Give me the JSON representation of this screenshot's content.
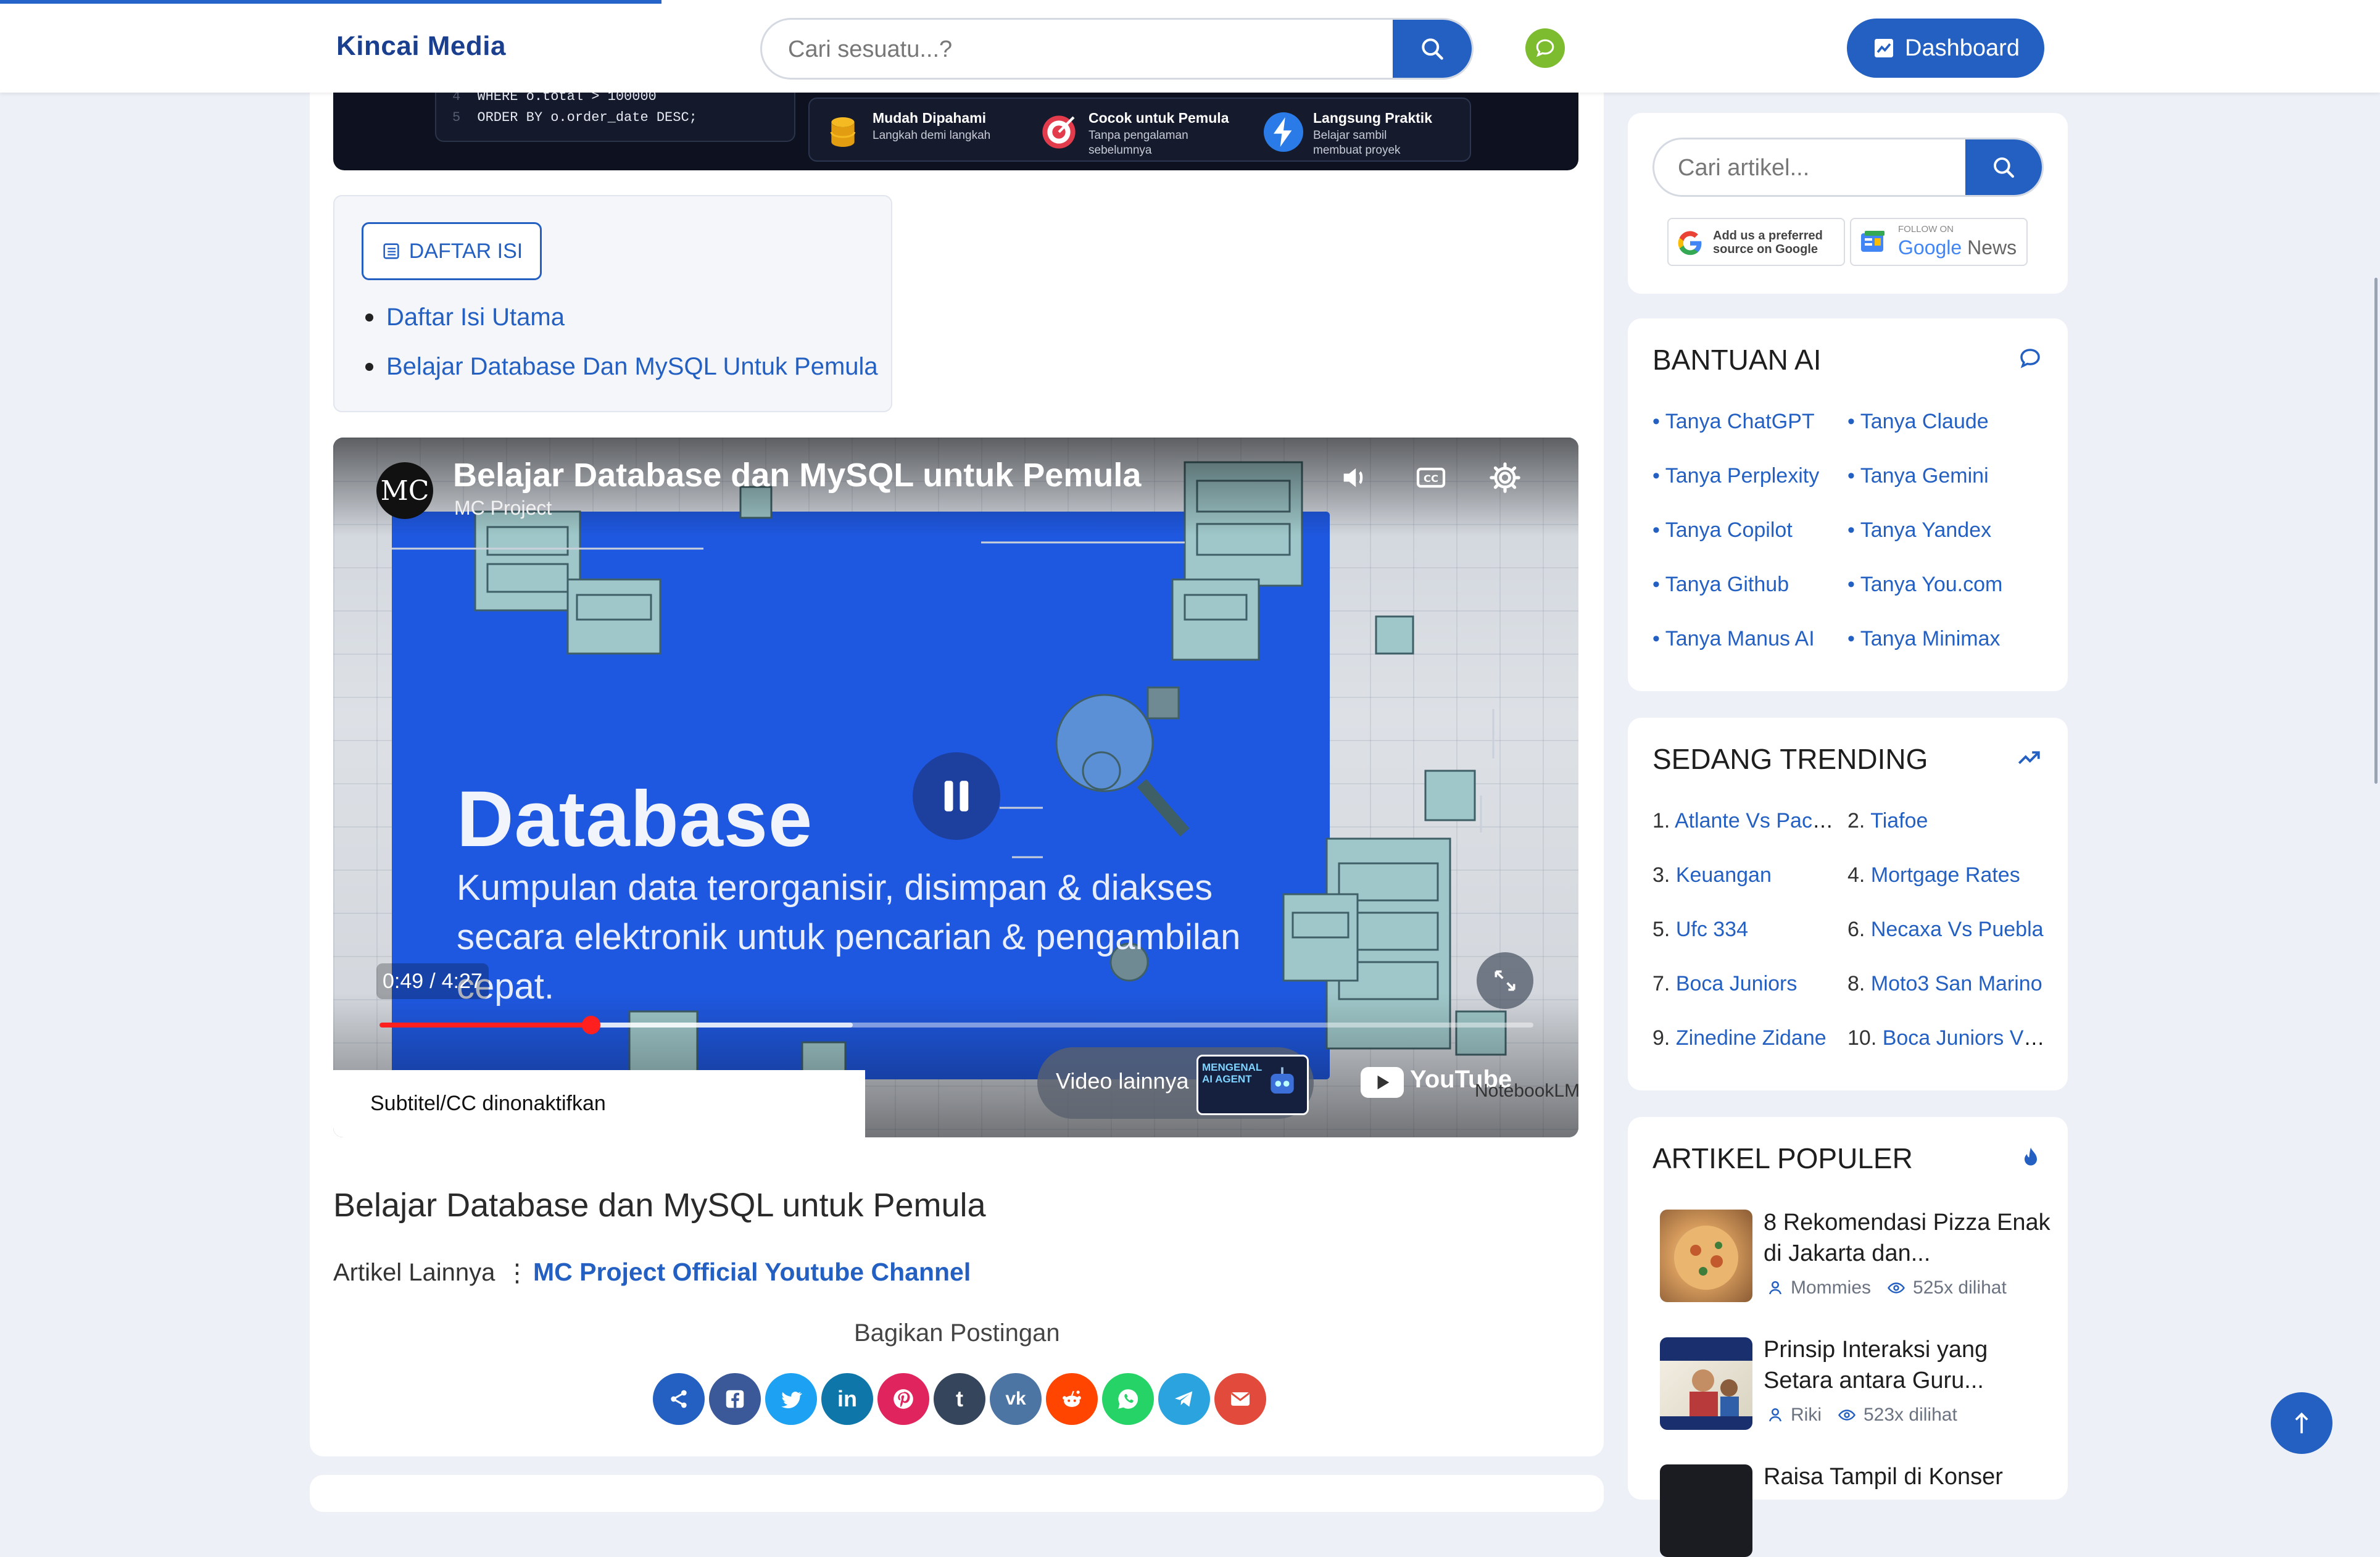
{
  "header": {
    "logo": "Kincai Media",
    "search_placeholder": "Cari sesuatu...?",
    "dashboard_label": "Dashboard"
  },
  "banner": {
    "code_lines": [
      {
        "no": "4",
        "text": "WHERE o.total > 100000"
      },
      {
        "no": "5",
        "text": "ORDER BY o.order_date DESC;"
      }
    ],
    "features": [
      {
        "title": "Mudah Dipahami",
        "sub": "Langkah demi langkah"
      },
      {
        "title": "Cocok untuk Pemula",
        "sub": "Tanpa pengalaman sebelumnya"
      },
      {
        "title": "Langsung Praktik",
        "sub": "Belajar sambil membuat proyek"
      }
    ]
  },
  "toc": {
    "button_label": "DAFTAR ISI",
    "items": [
      "Daftar Isi Utama",
      "Belajar Database Dan MySQL Untuk Pemula"
    ]
  },
  "video": {
    "avatar": "MC",
    "title": "Belajar Database dan MySQL untuk Pemula",
    "channel": "MC Project",
    "slide_headline": "Database",
    "slide_desc": "Kumpulan data terorganisir, disimpan & diakses secara elektronik untuk pencarian & pengambilan cepat.",
    "time_current": "0:49",
    "time_total": "4:27",
    "progress": 0.1835,
    "buffered": 0.41,
    "subtitle_status": "Subtitel/CC dinonaktifkan",
    "more_videos": "Video lainnya",
    "more_thumb_text": "MENGENAL AI AGENT",
    "youtube": "YouTube",
    "notebook": "NotebookLM"
  },
  "article": {
    "title": "Belajar Database dan MySQL untuk Pemula",
    "more_label": "Artikel Lainnya",
    "more_sep": "⋮",
    "more_link": "MC Project Official Youtube Channel",
    "share_label": "Bagikan Postingan"
  },
  "share_buttons": [
    {
      "name": "share",
      "glyph": "⋖",
      "color": "#2460c2"
    },
    {
      "name": "facebook",
      "glyph": "f",
      "color": "#3b5998"
    },
    {
      "name": "twitter",
      "glyph": "t",
      "color": "#1da1f2"
    },
    {
      "name": "linkedin",
      "glyph": "in",
      "color": "#0e76a8"
    },
    {
      "name": "pinterest",
      "glyph": "P",
      "color": "#e0245e"
    },
    {
      "name": "tumblr",
      "glyph": "t",
      "color": "#35465c"
    },
    {
      "name": "vk",
      "glyph": "vk",
      "color": "#4c75a3"
    },
    {
      "name": "reddit",
      "glyph": "r",
      "color": "#ff4500"
    },
    {
      "name": "whatsapp",
      "glyph": "w",
      "color": "#25d366"
    },
    {
      "name": "telegram",
      "glyph": "➤",
      "color": "#2aa3df"
    },
    {
      "name": "email",
      "glyph": "✉",
      "color": "#e24a3b"
    }
  ],
  "sidebar": {
    "search_placeholder": "Cari artikel...",
    "badge_google_line1": "Add us a preferred",
    "badge_google_line2": "source on Google",
    "badge_news_small": "FOLLOW ON",
    "badge_news_google": "Google",
    "badge_news_word": "News",
    "ai": {
      "title": "BANTUAN AI",
      "links": [
        "Tanya ChatGPT",
        "Tanya Claude",
        "Tanya Perplexity",
        "Tanya Gemini",
        "Tanya Copilot",
        "Tanya Yandex",
        "Tanya Github",
        "Tanya You.com",
        "Tanya Manus AI",
        "Tanya Minimax"
      ]
    },
    "trending": {
      "title": "SEDANG TRENDING",
      "items": [
        {
          "num": "1.",
          "text": "Atlante Vs Pachuca"
        },
        {
          "num": "2.",
          "text": "Tiafoe"
        },
        {
          "num": "3.",
          "text": "Keuangan"
        },
        {
          "num": "4.",
          "text": "Mortgage Rates"
        },
        {
          "num": "5.",
          "text": "Ufc 334"
        },
        {
          "num": "6.",
          "text": "Necaxa Vs Puebla"
        },
        {
          "num": "7.",
          "text": "Boca Juniors"
        },
        {
          "num": "8.",
          "text": "Moto3 San Marino"
        },
        {
          "num": "9.",
          "text": "Zinedine Zidane"
        },
        {
          "num": "10.",
          "text": "Boca Juniors Vs River"
        }
      ]
    },
    "popular": {
      "title": "ARTIKEL POPULER",
      "items": [
        {
          "title": "8 Rekomendasi Pizza Enak di Jakarta dan...",
          "author": "Mommies",
          "views": "525x dilihat"
        },
        {
          "title": "Prinsip Interaksi yang Setara antara Guru...",
          "author": "Riki",
          "views": "523x dilihat"
        },
        {
          "title": "Raisa Tampil di Konser",
          "author": "",
          "views": ""
        }
      ]
    }
  },
  "colors": {
    "brand": "#2460c2",
    "logo": "#1b3f8f",
    "chat_green": "#7dbb2f",
    "video_red": "#ff1f1f",
    "page_bg": "#edf0f7"
  }
}
